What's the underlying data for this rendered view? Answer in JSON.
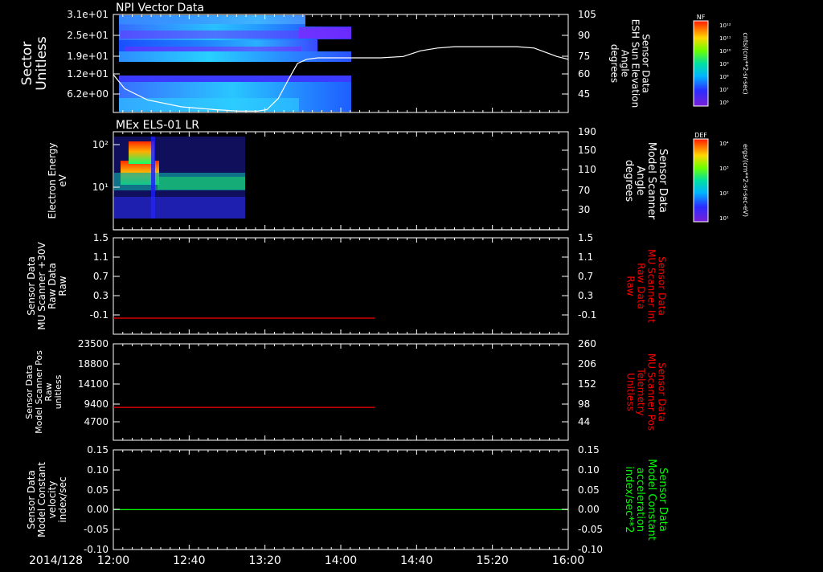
{
  "date_label": "2014/128",
  "time_ticks": [
    "12:00",
    "12:40",
    "13:20",
    "14:00",
    "14:40",
    "15:20",
    "16:00"
  ],
  "colors": {
    "axis": "#ffffff",
    "red": "#ff0000",
    "green": "#00ff00",
    "background": "#000000"
  },
  "panels": [
    {
      "title": "NPI Vector Data",
      "left_label": [
        "Sector",
        "Unitless"
      ],
      "right_label": [
        "Sensor Data",
        "ESH Sun Elevation",
        "Angle",
        "degrees"
      ],
      "left_ticks": [
        "3.1e+01",
        "2.5e+01",
        "1.9e+01",
        "1.2e+01",
        "6.2e+00"
      ],
      "right_ticks": [
        "105",
        "90",
        "75",
        "60",
        "45"
      ],
      "colorbar": {
        "label": "NF",
        "units": "cnts/(cm**2-sr-sec)",
        "ticks": [
          "10¹²",
          "10¹¹",
          "10¹⁰",
          "10⁹",
          "10⁸",
          "10⁷",
          "10⁶"
        ]
      }
    },
    {
      "title": "MEx ELS-01 LR",
      "left_label": [
        "Electron Energy",
        "eV"
      ],
      "right_label": [
        "Sensor Data",
        "Model Scanner",
        "Angle",
        "degrees"
      ],
      "left_ticks": [
        "10²",
        "10¹"
      ],
      "right_ticks": [
        "190",
        "150",
        "110",
        "70",
        "30"
      ],
      "colorbar": {
        "label": "DEF",
        "units": "ergs/(cm**2-sr-sec-eV)",
        "ticks": [
          "10⁴",
          "10³",
          "10²",
          "10¹"
        ]
      }
    },
    {
      "title": "",
      "left_label": [
        "Sensor Data",
        "MU Scanner +30V",
        "Raw Data",
        "Raw"
      ],
      "right_label": [
        "Sensor Data",
        "MU Scanner Int",
        "Raw Data",
        "Raw"
      ],
      "left_ticks": [
        "1.5",
        "1.1",
        "0.7",
        "0.3",
        "-0.1"
      ],
      "right_ticks": [
        "1.5",
        "1.1",
        "0.7",
        "0.3",
        "-0.1"
      ]
    },
    {
      "title": "",
      "left_label": [
        "Sensor Data",
        "Model Scanner Pos",
        "Raw",
        "unitless"
      ],
      "right_label": [
        "Sensor Data",
        "MU Scanner Pos",
        "Telemetry",
        "Unitless"
      ],
      "left_ticks": [
        "23500",
        "18800",
        "14100",
        "9400",
        "4700"
      ],
      "right_ticks": [
        "260",
        "206",
        "152",
        "98",
        "44"
      ]
    },
    {
      "title": "",
      "left_label": [
        "Sensor Data",
        "Model Constant",
        "velocity",
        "index/sec"
      ],
      "right_label": [
        "Sensor Data",
        "Model Constant",
        "acceleration",
        "index/sec**2"
      ],
      "left_ticks": [
        "0.15",
        "0.10",
        "0.05",
        "0.00",
        "-0.05",
        "-0.10"
      ],
      "right_ticks": [
        "0.15",
        "0.10",
        "0.05",
        "0.00",
        "-0.05",
        "-0.10"
      ]
    }
  ],
  "chart_data": [
    {
      "type": "heatmap",
      "title": "NPI Vector Data",
      "x_range": [
        "12:00",
        "16:00"
      ],
      "data_extent_end": "14:04",
      "ylabel": "Sector Unitless",
      "y2label": "Sensor Data ESH Sun Elevation Angle degrees",
      "y2lim": [
        35,
        105
      ],
      "series": [
        {
          "name": "ESH Sun Elevation Angle",
          "x_hours": [
            0.0,
            0.1,
            0.3,
            0.6,
            0.9,
            1.1,
            1.2,
            1.27,
            1.35,
            1.45,
            1.55,
            1.62,
            1.7,
            1.8,
            2.0,
            2.2,
            2.35,
            2.55,
            2.7,
            2.85,
            3.0,
            3.2,
            3.4,
            3.55,
            3.7,
            3.8,
            3.9,
            4.0
          ],
          "values": [
            62,
            52,
            44,
            39,
            37,
            36,
            36,
            36,
            37,
            45,
            60,
            70,
            73,
            74,
            74,
            74,
            74,
            75,
            79,
            81,
            82,
            82,
            82,
            82,
            81,
            78,
            75,
            73
          ]
        }
      ]
    },
    {
      "type": "heatmap",
      "title": "MEx ELS-01 LR",
      "x_range": [
        "12:00",
        "16:00"
      ],
      "data_extent_end": "12:56",
      "ylabel": "Electron Energy eV",
      "y2label": "Sensor Data Model Scanner Angle degrees",
      "y2lim": [
        10,
        190
      ],
      "series": [
        {
          "name": "Model Scanner Angle",
          "x_hours": [
            0,
            4
          ],
          "values": [
            10,
            10
          ]
        }
      ]
    },
    {
      "type": "line",
      "x_range": [
        "12:00",
        "16:00"
      ],
      "ylim": [
        -0.3,
        1.5
      ],
      "series": [
        {
          "name": "MU Scanner +30V",
          "x_hours": [
            0,
            2.3
          ],
          "values": [
            0,
            0
          ]
        }
      ]
    },
    {
      "type": "line",
      "x_range": [
        "12:00",
        "16:00"
      ],
      "ylim": [
        0,
        23500
      ],
      "series": [
        {
          "name": "Model Scanner Pos",
          "x_hours": [
            0,
            2.3
          ],
          "values": [
            8000,
            8000
          ]
        }
      ]
    },
    {
      "type": "line",
      "x_range": [
        "12:00",
        "16:00"
      ],
      "ylim": [
        -0.1,
        0.15
      ],
      "series": [
        {
          "name": "Model Constant velocity",
          "x_hours": [
            0,
            4
          ],
          "values": [
            0,
            0
          ]
        }
      ]
    }
  ]
}
